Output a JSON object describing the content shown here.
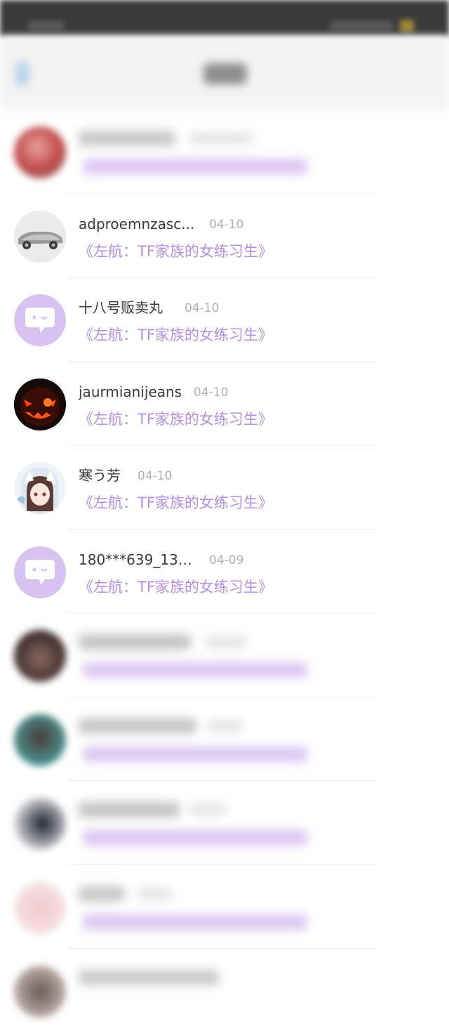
{
  "status_bar": {},
  "nav": {},
  "rows": [
    {
      "name": "",
      "date": "",
      "book": "",
      "avatar": "photo-blur",
      "blurred": true
    },
    {
      "name": "adproemnzasc...",
      "date": "04-10",
      "book": "《左航：TF家族的女练习生》",
      "avatar": "car-photo",
      "blurred": false
    },
    {
      "name": "十八号贩卖丸",
      "date": "04-10",
      "book": "《左航：TF家族的女练习生》",
      "avatar": "chat-bubble-icon",
      "blurred": false
    },
    {
      "name": "jaurmianijeans",
      "date": "04-10",
      "book": "《左航：TF家族的女练习生》",
      "avatar": "pumpkin-face",
      "blurred": false
    },
    {
      "name": "寒う芳",
      "date": "04-10",
      "book": "《左航：TF家族的女练习生》",
      "avatar": "anime-girl",
      "blurred": false
    },
    {
      "name": "180***639_131...",
      "date": "04-09",
      "book": "《左航：TF家族的女练习生》",
      "avatar": "chat-bubble-icon",
      "blurred": false
    },
    {
      "name": "",
      "date": "",
      "book": "",
      "avatar": "photo-blur",
      "blurred": true
    },
    {
      "name": "",
      "date": "",
      "book": "",
      "avatar": "photo-blur",
      "blurred": true
    },
    {
      "name": "",
      "date": "",
      "book": "",
      "avatar": "photo-blur",
      "blurred": true
    },
    {
      "name": "",
      "date": "",
      "book": "",
      "avatar": "photo-blur",
      "blurred": true
    },
    {
      "name": "",
      "date": "",
      "book": "",
      "avatar": "photo-blur",
      "blurred": true
    }
  ],
  "colors": {
    "accent": "#b48ee0",
    "status_bar": "#3a3a3a"
  }
}
